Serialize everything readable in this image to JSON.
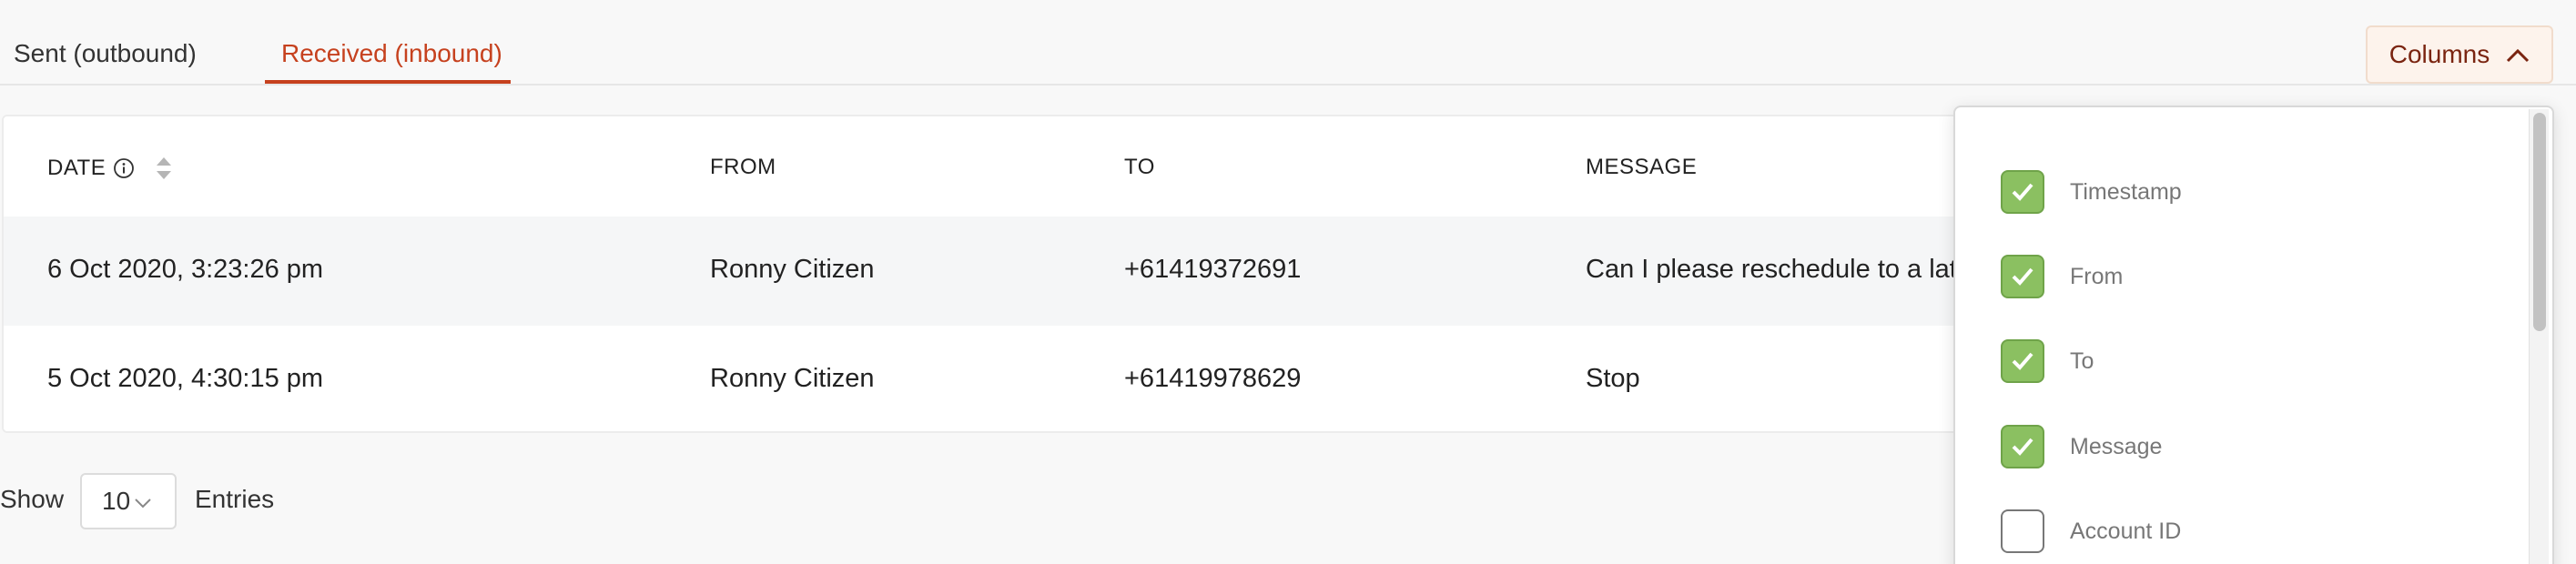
{
  "tabs": [
    {
      "label": "Sent (outbound)",
      "active": false
    },
    {
      "label": "Received (inbound)",
      "active": true
    }
  ],
  "columns_button": {
    "label": "Columns",
    "icon": "chevron-up-icon"
  },
  "table": {
    "headers": {
      "date": "DATE",
      "from": "FROM",
      "to": "TO",
      "message": "MESSAGE"
    },
    "rows": [
      {
        "date": "6 Oct 2020, 3:23:26 pm",
        "from": "Ronny Citizen",
        "to": "+61419372691",
        "message": "Can I please reschedule to a later"
      },
      {
        "date": "5 Oct 2020, 4:30:15 pm",
        "from": "Ronny Citizen",
        "to": "+61419978629",
        "message": "Stop"
      }
    ]
  },
  "pagination": {
    "show_label": "Show",
    "page_size": "10",
    "entries_label": "Entries"
  },
  "column_options": [
    {
      "label": "Timestamp",
      "checked": true
    },
    {
      "label": "From",
      "checked": true
    },
    {
      "label": "To",
      "checked": true
    },
    {
      "label": "Message",
      "checked": true
    },
    {
      "label": "Account ID",
      "checked": false
    }
  ],
  "colors": {
    "accent": "#c6411e",
    "checkbox_on": "#8bc061",
    "columns_button_bg": "#fdf3ec"
  }
}
